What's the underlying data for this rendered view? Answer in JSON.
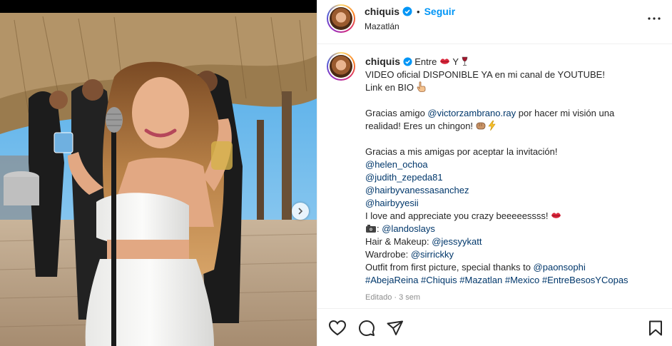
{
  "post": {
    "username": "chiquis",
    "follow_label": "Seguir",
    "separator": "•",
    "location": "Mazatlán",
    "photo_alt": "Photo"
  },
  "caption": {
    "username": "chiquis",
    "line1_text": "Entre",
    "line1_mid": "Y",
    "line2": "VIDEO oficial DISPONIBLE YA en mi canal de YOUTUBE!",
    "line3": "Link en BIO",
    "line4_pre": "Gracias amigo ",
    "line4_link": "@victorzambrano.ray",
    "line4_post": " por hacer mi visión una",
    "line5": "realidad! Eres un chingon!",
    "line6": "Gracias a mis amigas por aceptar la invitación!",
    "mention1": "@helen_ochoa",
    "mention2": "@judith_zepeda81",
    "mention3": "@hairbyvanessasanchez",
    "mention4": "@hairbyyesii",
    "line_love": "I love and appreciate you crazy beeeeessss!",
    "camera_sep": ": ",
    "camera_link": "@landoslays",
    "hair_pre": "Hair & Makeup: ",
    "hair_link": "@jessyykatt",
    "wardrobe_pre": "Wardrobe: ",
    "wardrobe_link": "@sirrickky",
    "outfit_pre": "Outfit from first picture, special thanks to ",
    "outfit_link": "@paonsophi",
    "hashtags": "#AbejaReina #Chiquis #Mazatlan #Mexico #EntreBesosYCopas",
    "meta": "Editado · 3 sem"
  },
  "icons": {
    "verified": "verified-badge-icon",
    "more": "more-options-icon",
    "like": "heart-icon",
    "comment": "comment-icon",
    "share": "paper-plane-icon",
    "save": "bookmark-icon",
    "next": "chevron-right-icon"
  },
  "colors": {
    "link": "#00376b",
    "follow": "#0095f6",
    "verified": "#0095f6",
    "muted": "#8e8e8e"
  }
}
